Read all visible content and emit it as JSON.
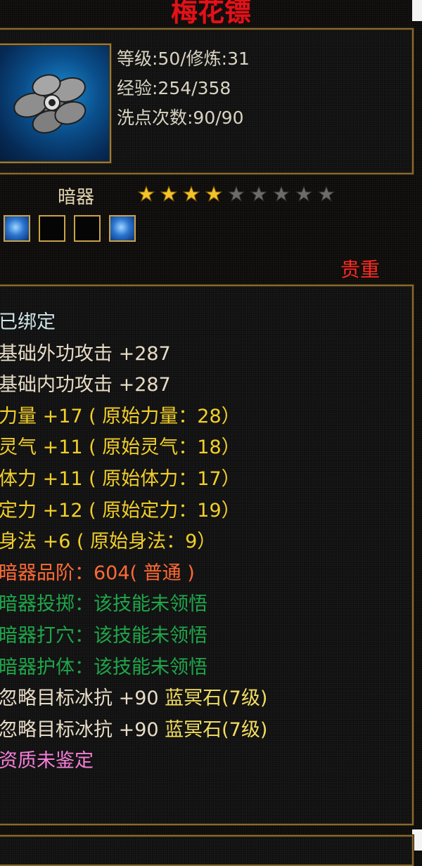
{
  "item": {
    "name": "梅花镖",
    "level_line": "等级:50/修炼:31",
    "exp_line": "经验:254/358",
    "wash_line": "洗点次数:90/90",
    "type": "暗器",
    "rarity": "贵重",
    "stars": {
      "filled": 4,
      "total": 9
    },
    "gem_slots": [
      "filled",
      "empty",
      "empty",
      "filled"
    ]
  },
  "stats": [
    {
      "text": "已绑定",
      "color": "white"
    },
    {
      "text": "基础外功攻击 +287",
      "color": "beige"
    },
    {
      "text": "基础内功攻击 +287",
      "color": "beige"
    },
    {
      "text": "力量 +17 ( 原始力量：28）",
      "color": "yellow"
    },
    {
      "text": "灵气 +11 ( 原始灵气：18）",
      "color": "yellow"
    },
    {
      "text": "体力 +11 ( 原始体力：17）",
      "color": "yellow"
    },
    {
      "text": "定力 +12 ( 原始定力：19）",
      "color": "yellow"
    },
    {
      "text": "身法 +6 ( 原始身法：9）",
      "color": "yellow"
    },
    {
      "text": "暗器品阶：604( 普通 )",
      "color": "orange"
    },
    {
      "text": "暗器投掷：该技能未领悟",
      "color": "green"
    },
    {
      "text": "暗器打穴：该技能未领悟",
      "color": "green"
    },
    {
      "text": "暗器护体：该技能未领悟",
      "color": "green"
    },
    {
      "text": "忽略目标冰抗 +90",
      "mid": "蓝冥石(7级)",
      "color": "beige"
    },
    {
      "text": "忽略目标冰抗 +90",
      "mid": "蓝冥石(7级)",
      "color": "beige"
    },
    {
      "text": "资质未鉴定",
      "color": "pink"
    }
  ],
  "icons": {
    "item_image": "plum-blossom-dart-icon",
    "star": "star-icon",
    "gem": "blue-gem-icon"
  },
  "colors": {
    "title": "#e1121a",
    "rarity": "#ff2a1f",
    "border": "#8b6a2f",
    "white": "#cfe6e8",
    "beige": "#e8dcc6",
    "yellow": "#f2cf2a",
    "orange": "#ff6a35",
    "green": "#1fa64a",
    "pink": "#f57fd8"
  }
}
